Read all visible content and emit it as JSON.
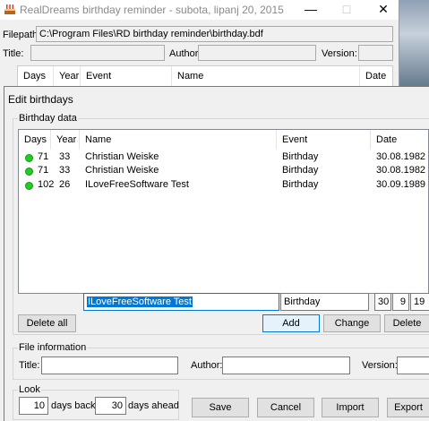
{
  "window": {
    "title": "RealDreams birthday reminder - subota, lipanj 20, 2015",
    "minimize": "—",
    "maximize": "□",
    "close": "✕"
  },
  "main": {
    "filepath_label": "Filepath:",
    "filepath_value": "C:\\Program Files\\RD birthday reminder\\birthday.bdf",
    "title_label": "Title:",
    "author_label": "Author:",
    "version_label": "Version:",
    "columns": [
      "Days",
      "Year",
      "Event",
      "Name",
      "Date"
    ]
  },
  "dialog": {
    "title": "Edit birthdays",
    "birthday_group": "Birthday data",
    "columns": [
      "Days",
      "Year",
      "Name",
      "Event",
      "Date"
    ],
    "rows": [
      {
        "days": "71",
        "year": "33",
        "name": "Christian Weiske",
        "event": "Birthday",
        "date": "30.08.1982",
        "status": "green"
      },
      {
        "days": "71",
        "year": "33",
        "name": "Christian Weiske",
        "event": "Birthday",
        "date": "30.08.1982",
        "status": "green"
      },
      {
        "days": "102",
        "year": "26",
        "name": "ILoveFreeSoftware Test",
        "event": "Birthday",
        "date": "30.09.1989",
        "status": "green"
      }
    ],
    "edit": {
      "name": "ILoveFreeSoftware Test",
      "event": "Birthday",
      "day": "30",
      "month": "9",
      "year": "19"
    },
    "buttons": {
      "delete_all": "Delete all",
      "add": "Add",
      "change": "Change",
      "delete": "Delete",
      "save": "Save",
      "cancel": "Cancel",
      "import": "Import",
      "export": "Export"
    },
    "file_info": {
      "group": "File information",
      "title_label": "Title:",
      "author_label": "Author:",
      "version_label": "Version:"
    },
    "look": {
      "group": "Look",
      "days_back_value": "10",
      "days_back_label": "days back",
      "days_ahead_value": "30",
      "days_ahead_label": "days ahead"
    }
  },
  "colors": {
    "status_green": "#1fcf1f",
    "selection": "#0078d7"
  }
}
